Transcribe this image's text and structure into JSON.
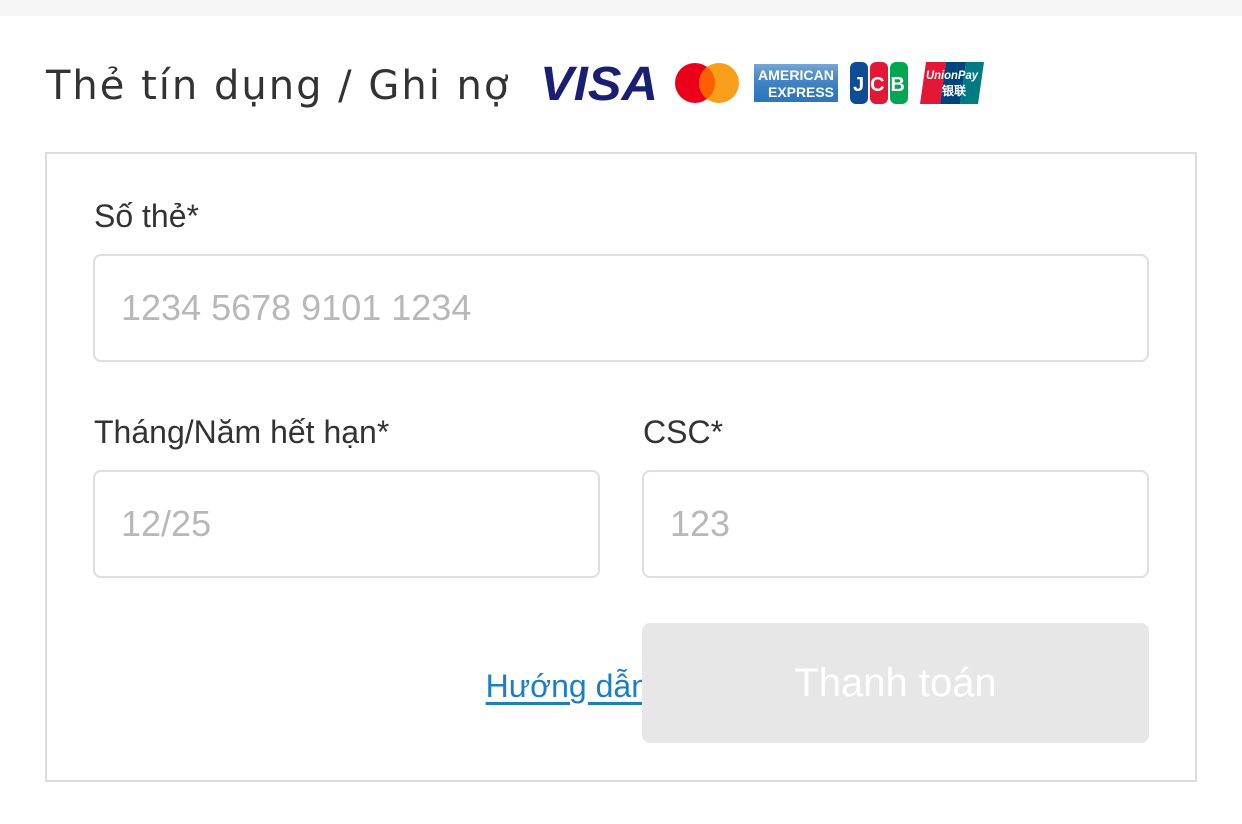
{
  "section": {
    "title": "Thẻ tín dụng / Ghi nợ"
  },
  "brands": {
    "visa": "VISA",
    "amex_line1": "AMERICAN",
    "amex_line2": "EXPRESS",
    "jcb": "JCB",
    "unionpay_line1": "UnionPay",
    "unionpay_line2": "银联"
  },
  "form": {
    "card_number": {
      "label": "Số thẻ*",
      "value": "",
      "placeholder": "1234 5678 9101 1234"
    },
    "expiry": {
      "label": "Tháng/Năm hết hạn*",
      "value": "",
      "placeholder": "12/25"
    },
    "csc": {
      "label": "CSC*",
      "value": "",
      "placeholder": "123"
    },
    "guide_link": "Hướng dẫn",
    "pay_button": "Thanh toán"
  },
  "colors": {
    "visa_blue": "#1a1f71",
    "mastercard_red": "#eb001b",
    "mastercard_orange": "#f79e1b",
    "amex_blue": "#2e77bc",
    "link_blue": "#1b7fc4",
    "button_disabled": "#e7e7e7",
    "border": "#dcdcdc"
  }
}
